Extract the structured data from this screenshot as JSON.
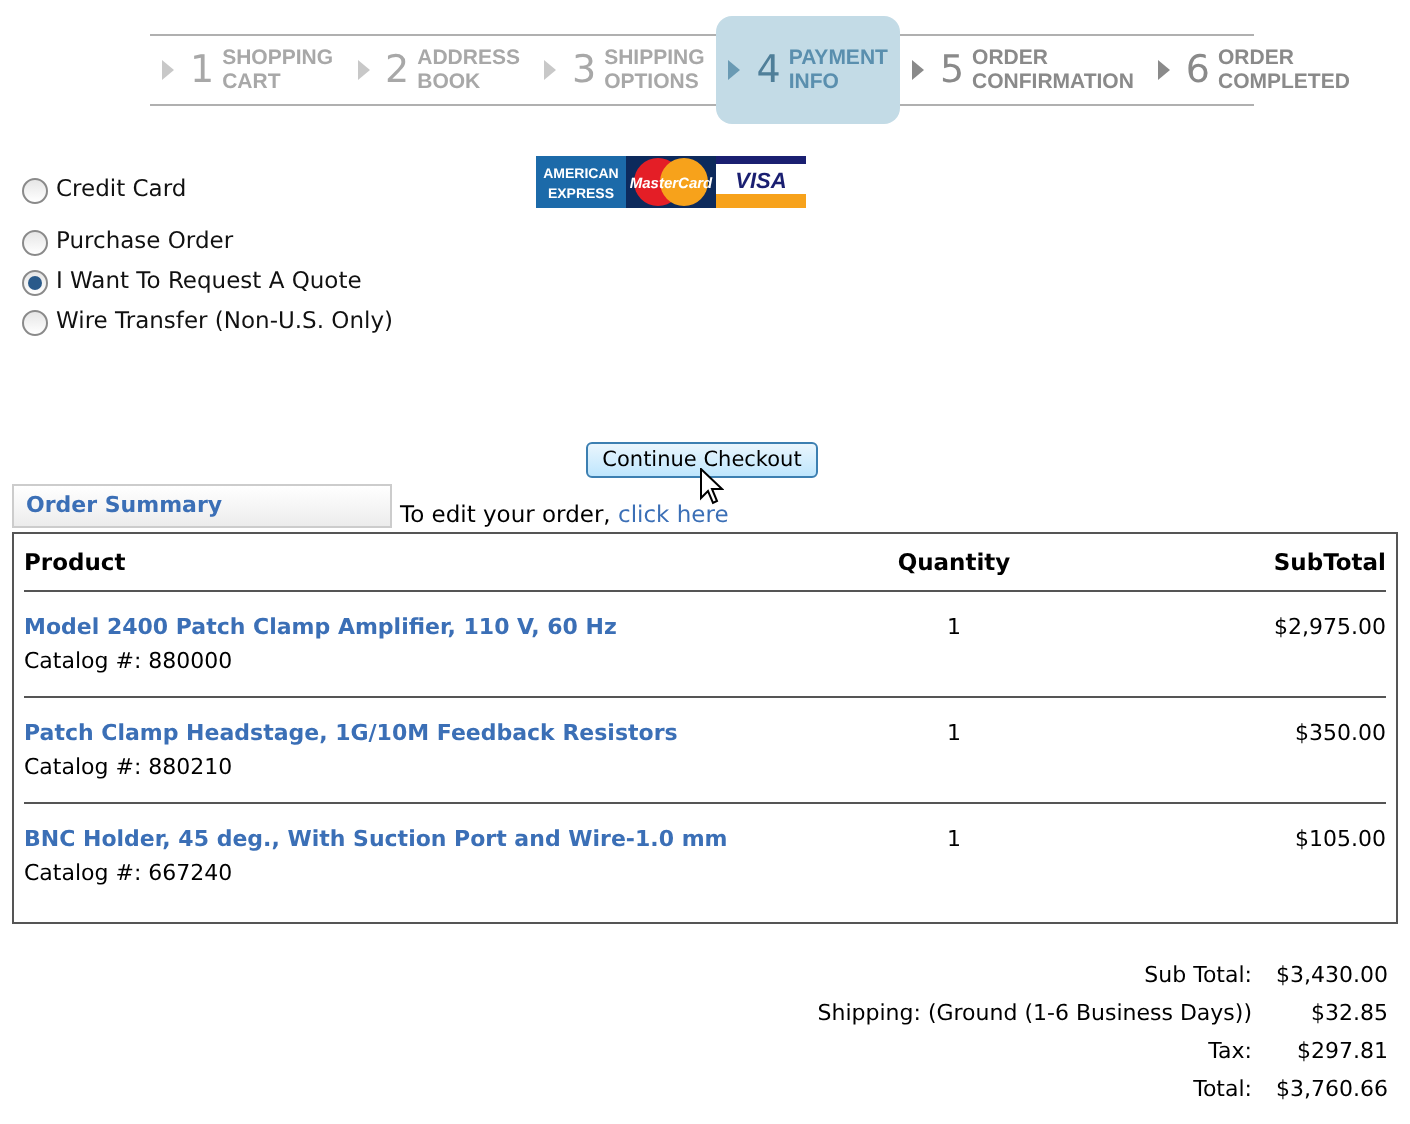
{
  "steps": [
    {
      "number": "1",
      "label": "SHOPPING CART",
      "kind": "done"
    },
    {
      "number": "2",
      "label": "ADDRESS BOOK",
      "kind": "done"
    },
    {
      "number": "3",
      "label": "SHIPPING OPTIONS",
      "kind": "done"
    },
    {
      "number": "4",
      "label": "PAYMENT INFO",
      "kind": "current"
    },
    {
      "number": "5",
      "label": "ORDER CONFIRMATION",
      "kind": "upcoming"
    },
    {
      "number": "6",
      "label": "ORDER COMPLETED",
      "kind": "upcoming"
    }
  ],
  "payment_options": [
    {
      "label": "Credit Card",
      "selected": false
    },
    {
      "label": "Purchase Order",
      "selected": false
    },
    {
      "label": "I Want To Request A Quote",
      "selected": true
    },
    {
      "label": "Wire Transfer (Non-U.S. Only)",
      "selected": false
    }
  ],
  "card_logos": [
    {
      "kind": "amex",
      "lines": [
        "AMERICAN",
        "EXPRESS"
      ]
    },
    {
      "kind": "mastercard",
      "lines": [
        "MasterCard"
      ]
    },
    {
      "kind": "visa",
      "lines": [
        "VISA"
      ]
    }
  ],
  "continue_button": "Continue Checkout",
  "summary_tab": "Order Summary",
  "edit_note": {
    "text": "To edit your order,",
    "link": "click here"
  },
  "table": {
    "columns": [
      "Product",
      "Quantity",
      "SubTotal"
    ],
    "rows": [
      {
        "product": "Model 2400 Patch Clamp Amplifier, 110 V, 60 Hz",
        "catalog_label": "Catalog #:",
        "catalog": "880000",
        "quantity": "1",
        "subtotal": "$2,975.00"
      },
      {
        "product": "Patch Clamp Headstage, 1G/10M Feedback Resistors",
        "catalog_label": "Catalog #:",
        "catalog": "880210",
        "quantity": "1",
        "subtotal": "$350.00"
      },
      {
        "product": "BNC Holder, 45 deg., With Suction Port and Wire-1.0 mm",
        "catalog_label": "Catalog #:",
        "catalog": "667240",
        "quantity": "1",
        "subtotal": "$105.00"
      }
    ]
  },
  "totals": [
    {
      "label": "Sub Total:",
      "value": "$3,430.00"
    },
    {
      "label": "Shipping: (Ground (1-6 Business Days))",
      "value": "$32.85"
    },
    {
      "label": "Tax:",
      "value": "$297.81"
    },
    {
      "label": "Total:",
      "value": "$3,760.66"
    }
  ]
}
